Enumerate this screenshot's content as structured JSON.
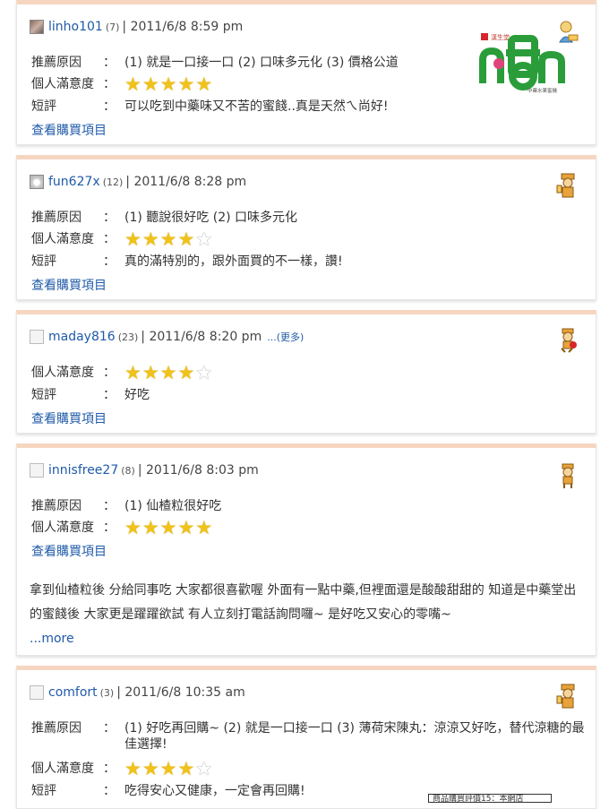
{
  "reviews": [
    {
      "user": "linho101",
      "count": "(7)",
      "date": "| 2011/6/8  8:59 pm",
      "reason_label": "推薦原因",
      "reason": "(1) 就是一口接一口   (2) 口味多元化   (3) 價格公道",
      "satisfaction_label": "個人滿意度",
      "stars": 5,
      "comment_label": "短評",
      "comment": "可以吃到中藥味又不苦的蜜餞..真是天然ㄟ尚好!",
      "view_link": "查看購買項目",
      "logo_text": "中藥水果蜜餞",
      "logo_top": "漢生堂"
    },
    {
      "user": "fun627x",
      "count": "(12)",
      "date": "| 2011/6/8  8:28 pm",
      "reason_label": "推薦原因",
      "reason": "(1) 聽說很好吃   (2) 口味多元化",
      "satisfaction_label": "個人滿意度",
      "stars": 4,
      "comment_label": "短評",
      "comment": "真的滿特別的，跟外面買的不一樣，讚!",
      "view_link": "查看購買項目"
    },
    {
      "user": "maday816",
      "count": "(23)",
      "date": "| 2011/6/8  8:20 pm",
      "more": "...(更多)",
      "satisfaction_label": "個人滿意度",
      "stars": 4,
      "comment_label": "短評",
      "comment": "好吃",
      "view_link": "查看購買項目"
    },
    {
      "user": "innisfree27",
      "count": "(8)",
      "date": "| 2011/6/8  8:03 pm",
      "reason_label": "推薦原因",
      "reason": "(1) 仙楂粒很好吃",
      "satisfaction_label": "個人滿意度",
      "stars": 5,
      "view_link": "查看購買項目",
      "review_text": "拿到仙楂粒後 分給同事吃 大家都很喜歡喔 外面有一點中藥,但裡面還是酸酸甜甜的 知道是中藥堂出的蜜餞後 大家更是躍躍欲試 有人立刻打電話詢問囉~ 是好吃又安心的零嘴~",
      "review_more": "...more"
    },
    {
      "user": "comfort",
      "count": "(3)",
      "date": "| 2011/6/8  10:35 am",
      "reason_label": "推薦原因",
      "reason": "(1) 好吃再回購~   (2) 就是一口接一口   (3) 薄荷宋陳丸：涼涼又好吃，替代涼糖的最佳選擇!",
      "satisfaction_label": "個人滿意度",
      "stars": 4,
      "comment_label": "短評",
      "comment": "吃得安心又健康，一定會再回購!"
    }
  ],
  "colon": "：",
  "ad_text": "商品購買評價15：本網店",
  "colors": {
    "link": "#1f5aa8",
    "card_top": "#f6d6c0",
    "star": "#f0c21a"
  }
}
